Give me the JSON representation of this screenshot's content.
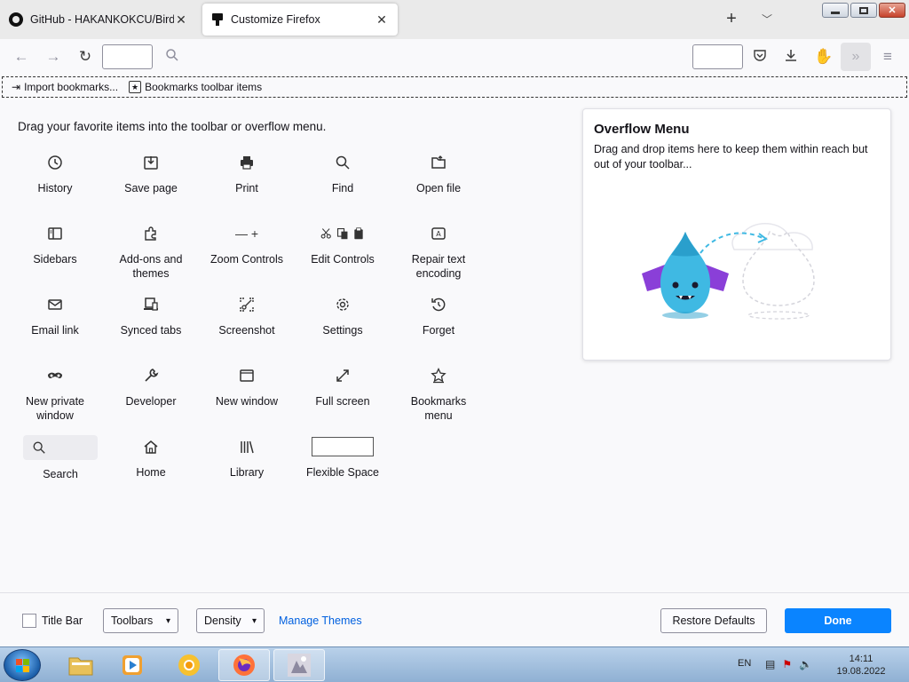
{
  "tabs": [
    {
      "label": "GitHub - HAKANKOKCU/BirdyI",
      "icon": "github-icon"
    },
    {
      "label": "Customize Firefox",
      "icon": "customize-icon"
    }
  ],
  "bookmarks_toolbar": {
    "items": [
      "Import bookmarks...",
      "Bookmarks toolbar items"
    ]
  },
  "palette": {
    "title": "Drag your favorite items into the toolbar or overflow menu.",
    "items": [
      {
        "label": "History",
        "icon": "history-icon"
      },
      {
        "label": "Save page",
        "icon": "save-page-icon"
      },
      {
        "label": "Print",
        "icon": "print-icon"
      },
      {
        "label": "Find",
        "icon": "find-icon"
      },
      {
        "label": "Open file",
        "icon": "open-file-icon"
      },
      {
        "label": "Sidebars",
        "icon": "sidebars-icon"
      },
      {
        "label": "Add-ons and themes",
        "icon": "addons-icon"
      },
      {
        "label": "Zoom Controls",
        "icon": "zoom-controls-icon",
        "glyph": "—   +"
      },
      {
        "label": "Edit Controls",
        "icon": "edit-controls-icon"
      },
      {
        "label": "Repair text encoding",
        "icon": "text-encoding-icon"
      },
      {
        "label": "Email link",
        "icon": "email-icon"
      },
      {
        "label": "Synced tabs",
        "icon": "synced-tabs-icon"
      },
      {
        "label": "Screenshot",
        "icon": "screenshot-icon"
      },
      {
        "label": "Settings",
        "icon": "settings-gear-icon"
      },
      {
        "label": "Forget",
        "icon": "forget-icon"
      },
      {
        "label": "New private window",
        "icon": "private-mask-icon"
      },
      {
        "label": "Developer",
        "icon": "wrench-icon"
      },
      {
        "label": "New window",
        "icon": "new-window-icon"
      },
      {
        "label": "Full screen",
        "icon": "fullscreen-icon"
      },
      {
        "label": "Bookmarks menu",
        "icon": "bookmarks-star-icon"
      },
      {
        "label": "Search",
        "icon": "search-icon"
      },
      {
        "label": "Home",
        "icon": "home-icon"
      },
      {
        "label": "Library",
        "icon": "library-icon"
      },
      {
        "label": "Flexible Space",
        "icon": "flexible-space"
      }
    ]
  },
  "overflow_menu": {
    "title": "Overflow Menu",
    "description": "Drag and drop items here to keep them within reach but out of your toolbar..."
  },
  "footer": {
    "title_bar_label": "Title Bar",
    "toolbars_label": "Toolbars",
    "density_label": "Density",
    "manage_themes_label": "Manage Themes",
    "restore_defaults_label": "Restore Defaults",
    "done_label": "Done"
  },
  "taskbar": {
    "language": "EN",
    "time": "14:11",
    "date": "19.08.2022"
  },
  "colors": {
    "accent": "#0a84ff",
    "link": "#0060df",
    "mascot": "#3fb9e3"
  }
}
